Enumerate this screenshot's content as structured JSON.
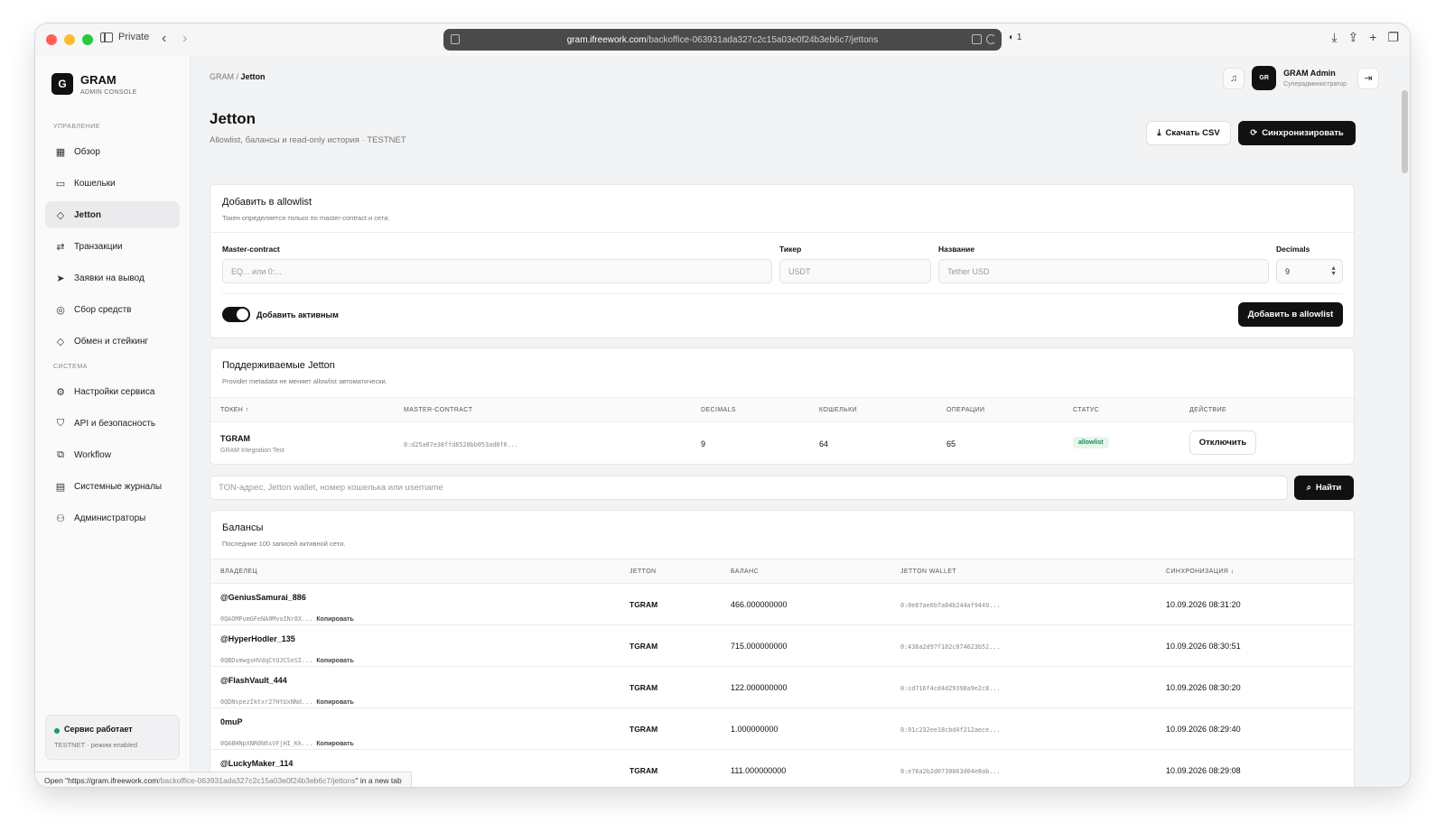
{
  "browser": {
    "private_label": "Private",
    "url_host": "gram.ifreework.com",
    "url_path": "/backoffice-063931ada327c2c15a03e0f24b3eb6c7/jettons",
    "extension_badge": "◐ 1",
    "status_prefix": "Open \"https://gram.ifreework.com",
    "status_path": "/backoffice-063931ada327c2c15a03e0f24b3eb6c7/jettons",
    "status_suffix": "\" in a new tab"
  },
  "app": {
    "logo_letter": "G",
    "name": "GRAM",
    "subtitle": "ADMIN CONSOLE"
  },
  "sidebar": {
    "section_manage": "УПРАВЛЕНИЕ",
    "section_system": "СИСТЕМА",
    "items": [
      {
        "label": "Обзор",
        "icon": "grid-icon"
      },
      {
        "label": "Кошельки",
        "icon": "wallet-icon"
      },
      {
        "label": "Jetton",
        "icon": "diamond-icon"
      },
      {
        "label": "Транзакции",
        "icon": "arrows-icon"
      },
      {
        "label": "Заявки на вывод",
        "icon": "send-icon"
      },
      {
        "label": "Сбор средств",
        "icon": "circle-icon"
      },
      {
        "label": "Обмен и стейкинг",
        "icon": "diamond-icon"
      },
      {
        "label": "Настройки сервиса",
        "icon": "gear-icon"
      },
      {
        "label": "API и безопасность",
        "icon": "shield-icon"
      },
      {
        "label": "Workflow",
        "icon": "workflow-icon"
      },
      {
        "label": "Системные журналы",
        "icon": "doc-icon"
      },
      {
        "label": "Администраторы",
        "icon": "users-icon"
      }
    ],
    "status_title": "Сервис работает",
    "status_sub": "TESTNET · режим enabled"
  },
  "header": {
    "breadcrumb_root": "GRAM",
    "breadcrumb_sep": " / ",
    "breadcrumb_current": "Jetton",
    "avatar": "GR",
    "user_name": "GRAM Admin",
    "user_role": "Суперадминистратор"
  },
  "page": {
    "title": "Jetton",
    "subtitle": "Allowlist, балансы и read-only история · TESTNET",
    "csv_button": "Скачать CSV",
    "sync_button": "Синхронизировать"
  },
  "allowlist_form": {
    "title": "Добавить в allowlist",
    "subtitle": "Токен определяется только по master-contract и сети.",
    "master_label": "Master-contract",
    "master_placeholder": "EQ... или 0:...",
    "ticker_label": "Тикер",
    "ticker_placeholder": "USDT",
    "name_label": "Название",
    "name_placeholder": "Tether USD",
    "decimals_label": "Decimals",
    "decimals_value": "9",
    "toggle_label": "Добавить активным",
    "toggle_on": true,
    "submit": "Добавить в allowlist"
  },
  "supported": {
    "title": "Поддерживаемые Jetton",
    "subtitle": "Provider metadata не меняет allowlist автоматически.",
    "columns": [
      "ТОКЕН ↑",
      "MASTER-CONTRACT",
      "DECIMALS",
      "КОШЕЛЬКИ",
      "ОПЕРАЦИИ",
      "СТАТУС",
      "ДЕЙСТВИЕ"
    ],
    "rows": [
      {
        "token": "TGRAM",
        "token_sub": "GRAM Integration Test",
        "master": "0:d25a07e38ffd8528bb053ad8f6...",
        "decimals": "9",
        "wallets": "64",
        "operations": "65",
        "status": "allowlist",
        "action": "Отключить"
      }
    ]
  },
  "search": {
    "placeholder": "TON-адрес, Jetton wallet, номер кошелька или username",
    "button": "Найти"
  },
  "balances": {
    "title": "Балансы",
    "subtitle": "Последние 100 записей активной сети.",
    "columns": [
      "ВЛАДЕЛЕЦ",
      "JETTON",
      "БАЛАНС",
      "JETTON WALLET",
      "СИНХРОНИЗАЦИЯ ↓"
    ],
    "copy_label": "Копировать",
    "rows": [
      {
        "owner": "@GeniusSamurai_886",
        "address": "0QAOMPumGFeNA0MvoINr8X...",
        "jetton": "TGRAM",
        "balance": "466.000000000",
        "wallet": "0:0e67ae6b7a04b244af9449...",
        "sync": "10.09.2026 08:31:20"
      },
      {
        "owner": "@HyperHodler_135",
        "address": "0QBDvmwgsHVdqCtUJCSeSI...",
        "jetton": "TGRAM",
        "balance": "715.000000000",
        "wallet": "0:436a2d97f102c874623b52...",
        "sync": "10.09.2026 08:30:51"
      },
      {
        "owner": "@FlashVault_444",
        "address": "0QDNspezIktxr27HtUxNNd...",
        "jetton": "TGRAM",
        "balance": "122.000000000",
        "wallet": "0:cd716f4cd4d29398a9e2c8...",
        "sync": "10.09.2026 08:30:20"
      },
      {
        "owner": "0muP",
        "address": "0QABHNpXNR0N6sVFjHI_Kk...",
        "jetton": "TGRAM",
        "balance": "1.000000000",
        "wallet": "0:01c232ee18cbd4f212aece...",
        "sync": "10.09.2026 08:29:40"
      },
      {
        "owner": "@LuckyMaker_114",
        "address": "",
        "jetton": "TGRAM",
        "balance": "111.000000000",
        "wallet": "0:e76a2b2d0730863d04e8ab...",
        "sync": "10.09.2026 08:29:08"
      }
    ]
  }
}
